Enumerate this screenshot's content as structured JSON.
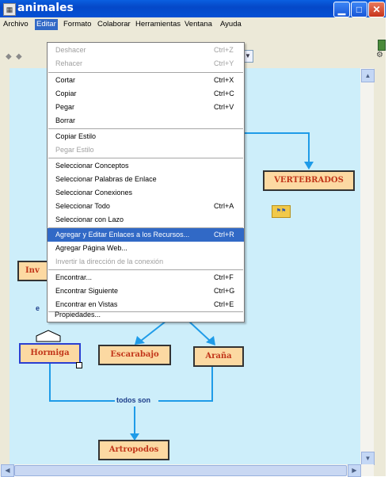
{
  "window": {
    "title": "animales"
  },
  "menubar": {
    "items": [
      {
        "label": "Archivo"
      },
      {
        "label": "Editar"
      },
      {
        "label": "Formato"
      },
      {
        "label": "Colaborar"
      },
      {
        "label": "Herramientas"
      },
      {
        "label": "Ventana"
      },
      {
        "label": "Ayuda"
      }
    ]
  },
  "edit_menu": {
    "items": [
      {
        "label": "Deshacer",
        "shortcut": "Ctrl+Z",
        "enabled": false
      },
      {
        "label": "Rehacer",
        "shortcut": "Ctrl+Y",
        "enabled": false
      },
      {
        "label": "Cortar",
        "shortcut": "Ctrl+X",
        "enabled": true
      },
      {
        "label": "Copiar",
        "shortcut": "Ctrl+C",
        "enabled": true
      },
      {
        "label": "Pegar",
        "shortcut": "Ctrl+V",
        "enabled": true
      },
      {
        "label": "Borrar",
        "shortcut": "",
        "enabled": true
      },
      {
        "label": "Copiar Estilo",
        "shortcut": "",
        "enabled": true
      },
      {
        "label": "Pegar Estilo",
        "shortcut": "",
        "enabled": false
      },
      {
        "label": "Seleccionar Conceptos",
        "shortcut": "",
        "enabled": true
      },
      {
        "label": "Seleccionar Palabras de Enlace",
        "shortcut": "",
        "enabled": true
      },
      {
        "label": "Seleccionar Conexiones",
        "shortcut": "",
        "enabled": true
      },
      {
        "label": "Seleccionar Todo",
        "shortcut": "Ctrl+A",
        "enabled": true
      },
      {
        "label": "Seleccionar con Lazo",
        "shortcut": "",
        "enabled": true
      },
      {
        "label": "Agregar y Editar Enlaces a los Recursos...",
        "shortcut": "Ctrl+R",
        "enabled": true,
        "highlighted": true
      },
      {
        "label": "Agregar Página Web...",
        "shortcut": "",
        "enabled": true
      },
      {
        "label": "Invertir la dirección de la conexión",
        "shortcut": "",
        "enabled": false
      },
      {
        "label": "Encontrar...",
        "shortcut": "Ctrl+F",
        "enabled": true
      },
      {
        "label": "Encontrar Siguiente",
        "shortcut": "Ctrl+G",
        "enabled": true
      },
      {
        "label": "Encontrar en Vistas",
        "shortcut": "Ctrl+E",
        "enabled": true
      },
      {
        "label": "Propiedades...",
        "shortcut": "",
        "enabled": true
      }
    ]
  },
  "concept_map": {
    "concepts": {
      "vertebrados": "VERTEBRADOS",
      "invertebrados": "Inv",
      "hormiga": "Hormiga",
      "escarabajo": "Escarabajo",
      "arana": "Araña",
      "artropodos": "Artropodos"
    },
    "link_words": {
      "todos_son": "todos son",
      "partial": "e"
    }
  },
  "colors": {
    "canvas": "#cdeefa",
    "line": "#1e9be8",
    "menu_highlight": "#3169c6",
    "concept_fill": "#fcd9a2",
    "concept_text": "#c2361a"
  },
  "icons": {
    "window": "app-icon",
    "minimize": "minimize-icon",
    "maximize": "maximize-icon",
    "close": "close-icon",
    "resource": "resource-link-icon"
  }
}
